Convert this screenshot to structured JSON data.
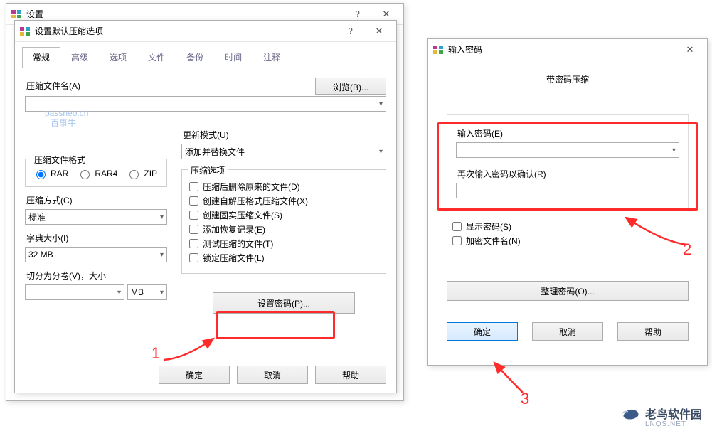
{
  "watermark": {
    "line1": "passneo.cn",
    "line2": "百事牛"
  },
  "bg_window": {
    "title": "设置"
  },
  "dialog1": {
    "title": "设置默认压缩选项",
    "tabs": [
      "常规",
      "高级",
      "选项",
      "文件",
      "备份",
      "时间",
      "注释"
    ],
    "active_tab_index": 0,
    "archive_name_label": "压缩文件名(A)",
    "archive_name_value": "",
    "browse_btn": "浏览(B)...",
    "update_mode_label": "更新模式(U)",
    "update_mode_value": "添加并替换文件",
    "format_group": "压缩文件格式",
    "formats": [
      "RAR",
      "RAR4",
      "ZIP"
    ],
    "format_selected_index": 0,
    "method_label": "压缩方式(C)",
    "method_value": "标准",
    "dict_label": "字典大小(I)",
    "dict_value": "32 MB",
    "split_label": "切分为分卷(V)，大小",
    "split_value": "",
    "split_unit": "MB",
    "options_group": "压缩选项",
    "options": [
      "压缩后删除原来的文件(D)",
      "创建自解压格式压缩文件(X)",
      "创建固实压缩文件(S)",
      "添加恢复记录(E)",
      "测试压缩的文件(T)",
      "锁定压缩文件(L)"
    ],
    "set_password_btn": "设置密码(P)...",
    "ok_btn": "确定",
    "cancel_btn": "取消",
    "help_btn": "帮助"
  },
  "dialog2": {
    "title": "输入密码",
    "heading": "带密码压缩",
    "enter_label": "输入密码(E)",
    "enter_value": "",
    "reenter_label": "再次输入密码以确认(R)",
    "reenter_value": "",
    "show_pw": "显示密码(S)",
    "encrypt_names": "加密文件名(N)",
    "organize_btn": "整理密码(O)...",
    "ok_btn": "确定",
    "cancel_btn": "取消",
    "help_btn": "帮助"
  },
  "annotations": {
    "n1": "1",
    "n2": "2",
    "n3": "3"
  },
  "footer": {
    "name": "老鸟软件园",
    "sub": "LNQS.NET"
  }
}
